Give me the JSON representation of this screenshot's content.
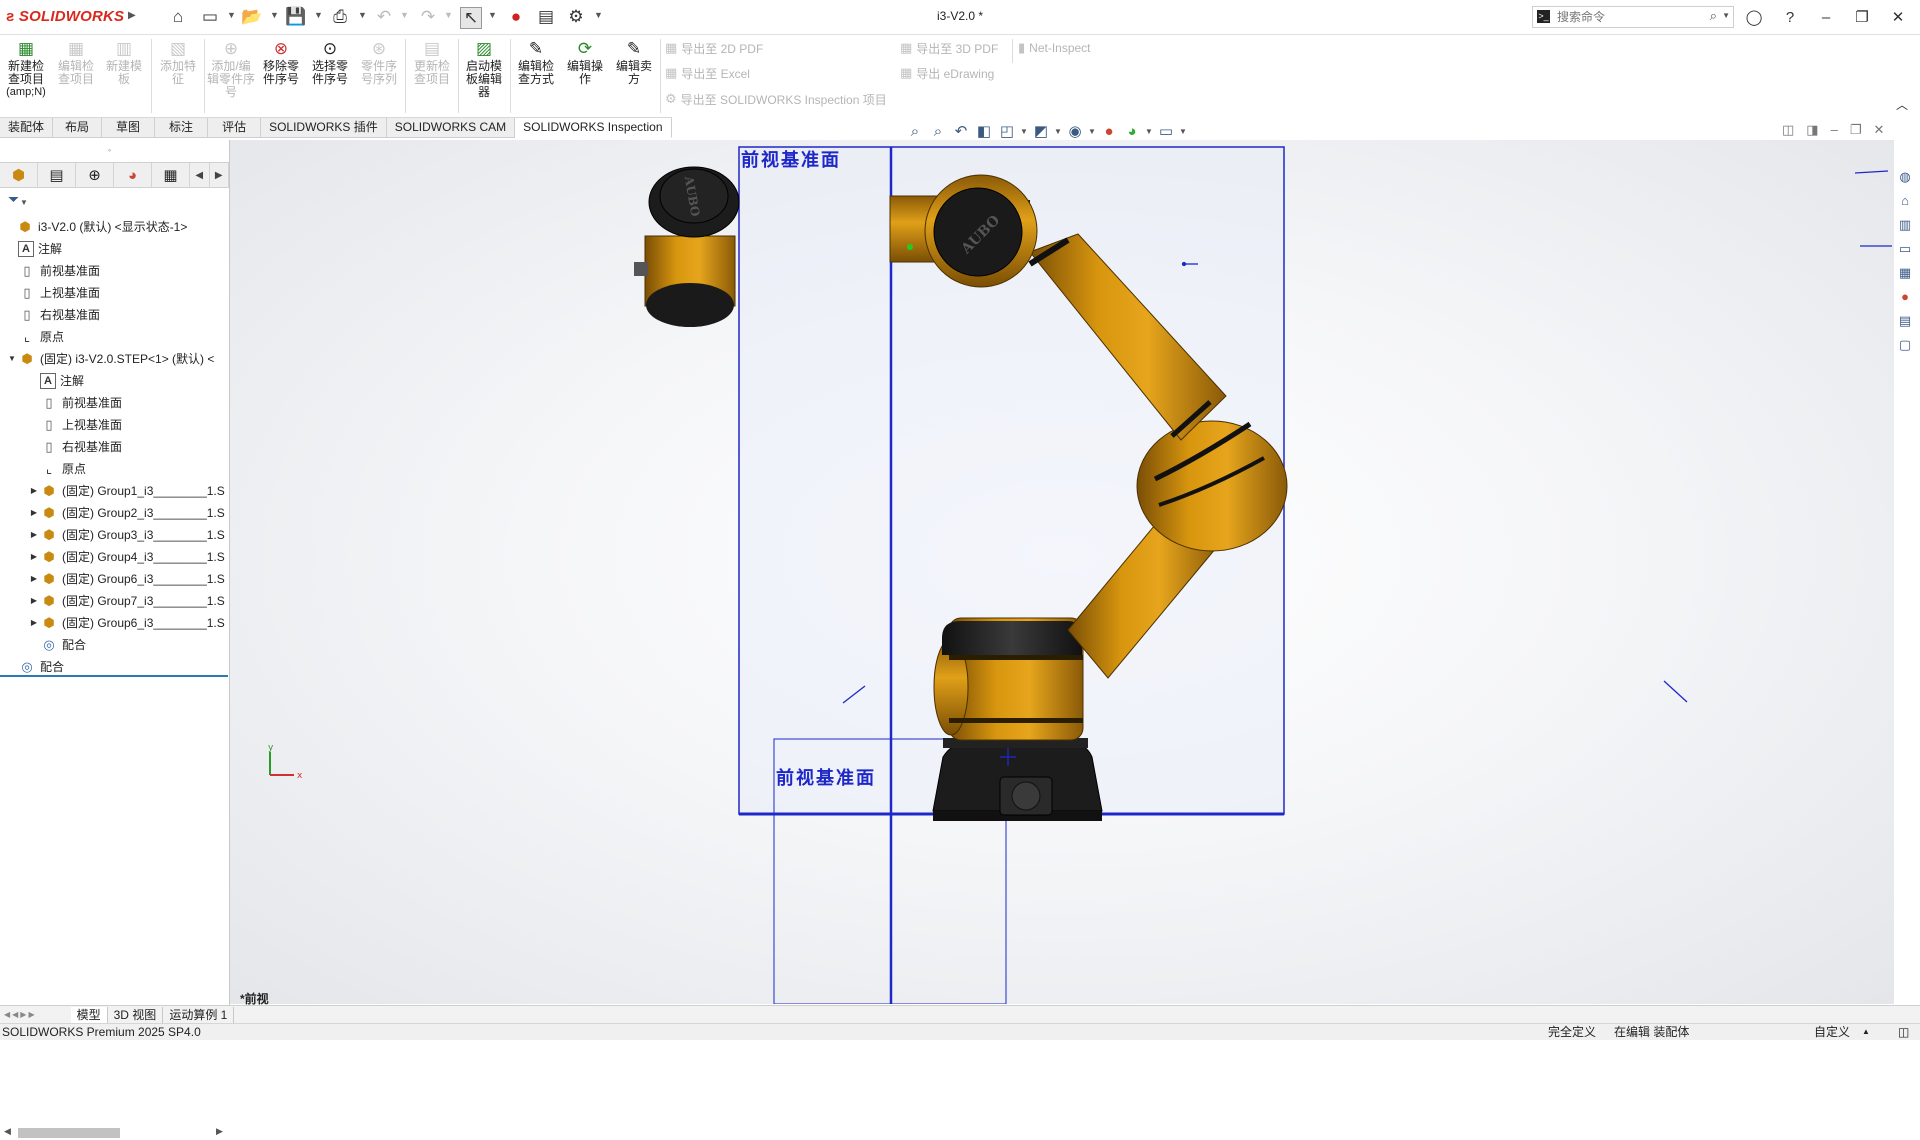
{
  "app": {
    "logo_text": "SOLIDWORKS",
    "document_title": "i3-V2.0 *",
    "search_placeholder": "搜索命令"
  },
  "ribbon": {
    "buttons": [
      {
        "label": "新建检查项目",
        "sub": "(amp;N)",
        "enabled": true
      },
      {
        "label": "编辑检查项目",
        "enabled": false
      },
      {
        "label": "新建模板",
        "enabled": false
      },
      {
        "label": "添加特征",
        "enabled": false
      },
      {
        "label": "添加/编辑零件序号",
        "enabled": false
      },
      {
        "label": "移除零件序号",
        "enabled": true
      },
      {
        "label": "选择零件序号",
        "enabled": true
      },
      {
        "label": "零件序号序列",
        "enabled": false
      },
      {
        "label": "更新检查项目",
        "enabled": false
      },
      {
        "label": "启动模板编辑器",
        "enabled": true
      },
      {
        "label": "编辑检查方式",
        "enabled": true
      },
      {
        "label": "编辑操作",
        "enabled": true
      },
      {
        "label": "编辑卖方",
        "enabled": true
      }
    ],
    "exports": [
      "导出至 2D PDF",
      "导出至 Excel",
      "导出至 SOLIDWORKS Inspection 项目",
      "导出至 3D PDF",
      "导出 eDrawing",
      "Net-Inspect"
    ]
  },
  "tabs": [
    "装配体",
    "布局",
    "草图",
    "标注",
    "评估",
    "SOLIDWORKS 插件",
    "SOLIDWORKS CAM",
    "SOLIDWORKS Inspection"
  ],
  "active_tab": "SOLIDWORKS Inspection",
  "tree": [
    {
      "label": "i3-V2.0 (默认) <显示状态-1>",
      "level": 0,
      "icon": "assembly-icon",
      "expander": ""
    },
    {
      "label": "注解",
      "level": 1,
      "icon": "annotation-icon",
      "expander": ""
    },
    {
      "label": "前视基准面",
      "level": 1,
      "icon": "plane-icon",
      "expander": ""
    },
    {
      "label": "上视基准面",
      "level": 1,
      "icon": "plane-icon",
      "expander": ""
    },
    {
      "label": "右视基准面",
      "level": 1,
      "icon": "plane-icon",
      "expander": ""
    },
    {
      "label": "原点",
      "level": 1,
      "icon": "origin-icon",
      "expander": ""
    },
    {
      "label": "(固定) i3-V2.0.STEP<1> (默认) <",
      "level": 1,
      "icon": "subassembly-icon",
      "expander": "▼"
    },
    {
      "label": "注解",
      "level": 2,
      "icon": "annotation-icon",
      "expander": ""
    },
    {
      "label": "前视基准面",
      "level": 2,
      "icon": "plane-icon",
      "expander": ""
    },
    {
      "label": "上视基准面",
      "level": 2,
      "icon": "plane-icon",
      "expander": ""
    },
    {
      "label": "右视基准面",
      "level": 2,
      "icon": "plane-icon",
      "expander": ""
    },
    {
      "label": "原点",
      "level": 2,
      "icon": "origin-icon",
      "expander": ""
    },
    {
      "label": "(固定) Group1_i3________1.S",
      "level": 2,
      "icon": "subassembly-icon",
      "expander": "▶"
    },
    {
      "label": "(固定) Group2_i3________1.S",
      "level": 2,
      "icon": "subassembly-icon",
      "expander": "▶"
    },
    {
      "label": "(固定) Group3_i3________1.S",
      "level": 2,
      "icon": "subassembly-icon",
      "expander": "▶"
    },
    {
      "label": "(固定) Group4_i3________1.S",
      "level": 2,
      "icon": "subassembly-icon",
      "expander": "▶"
    },
    {
      "label": "(固定) Group6_i3________1.S",
      "level": 2,
      "icon": "subassembly-icon",
      "expander": "▶"
    },
    {
      "label": "(固定) Group7_i3________1.S",
      "level": 2,
      "icon": "subassembly-icon",
      "expander": "▶"
    },
    {
      "label": "(固定) Group6_i3________1.S",
      "level": 2,
      "icon": "subassembly-icon",
      "expander": "▶"
    },
    {
      "label": "配合",
      "level": 2,
      "icon": "mates-icon",
      "expander": ""
    },
    {
      "label": "配合",
      "level": 1,
      "icon": "mates-icon",
      "expander": ""
    }
  ],
  "viewport": {
    "plane_label": "前视基准面",
    "view_name": "*前视",
    "robot_brand": "AUBO"
  },
  "bottom_tabs": [
    "模型",
    "3D 视图",
    "运动算例 1"
  ],
  "status": {
    "product": "SOLIDWORKS Premium 2025 SP4.0",
    "definition": "完全定义",
    "mode": "在编辑 装配体",
    "units": "自定义"
  },
  "colors": {
    "brand_red": "#da291c",
    "plane_blue": "#1e28c8",
    "robot_orange": "#c98a12",
    "robot_dark": "#2b2b2b"
  }
}
